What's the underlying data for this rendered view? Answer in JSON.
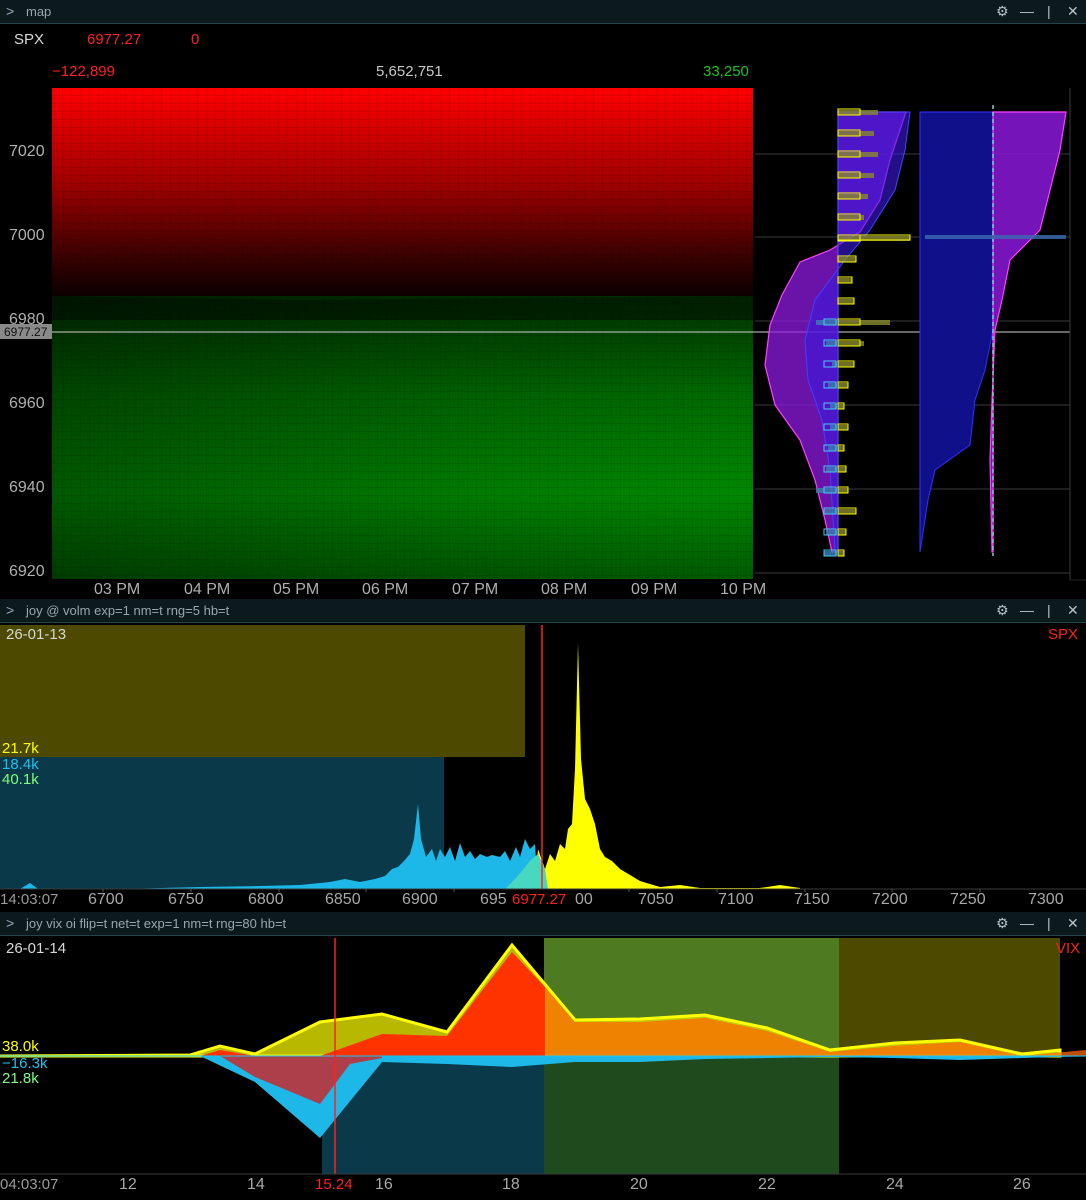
{
  "map": {
    "title": "map",
    "symbol": "SPX",
    "price": "6977.27",
    "change": "0",
    "left_value": "−122,899",
    "mid_value": "5,652,751",
    "right_value": "33,250",
    "y_ticks": [
      "7020",
      "7000",
      "6980",
      "6960",
      "6940",
      "6920"
    ],
    "price_tag": "6977.27",
    "x_ticks": [
      "03 PM",
      "04 PM",
      "05 PM",
      "06 PM",
      "07 PM",
      "08 PM",
      "09 PM",
      "10 PM"
    ]
  },
  "volm": {
    "title": "joy @ volm exp=1 nm=t rng=5 hb=t",
    "date": "26-01-13",
    "symbol": "SPX",
    "stat_yellow": "21.7k",
    "stat_cyan": "18.4k",
    "stat_green": "40.1k",
    "x_ticks": [
      "6700",
      "6750",
      "6800",
      "6850",
      "6900",
      "695",
      "00",
      "7050",
      "7100",
      "7150",
      "7200",
      "7250",
      "7300"
    ],
    "left_label": "14:03:07",
    "price_label": "6977.27"
  },
  "vix": {
    "title": "joy vix oi flip=t net=t exp=1 nm=t rng=80 hb=t",
    "date": "26-01-14",
    "symbol": "VIX",
    "stat_yellow": "38.0k",
    "stat_cyan": "−16.3k",
    "stat_green": "21.8k",
    "time_label": "04:03:07",
    "x_ticks": [
      "12",
      "14",
      "16",
      "18",
      "20",
      "22",
      "24",
      "26"
    ],
    "price_label": "15.24"
  },
  "controls": {
    "gear": "⚙",
    "minimize": "—",
    "restore": "|",
    "close": "✕",
    "chevron": ">"
  },
  "colors": {
    "red": "#ff2020",
    "green": "#00a000",
    "yellow": "#ffff00",
    "cyan": "#1ec0f0",
    "lightgreen": "#7dff7d",
    "purple": "#a020f0",
    "blue": "#1a1ad8"
  }
}
